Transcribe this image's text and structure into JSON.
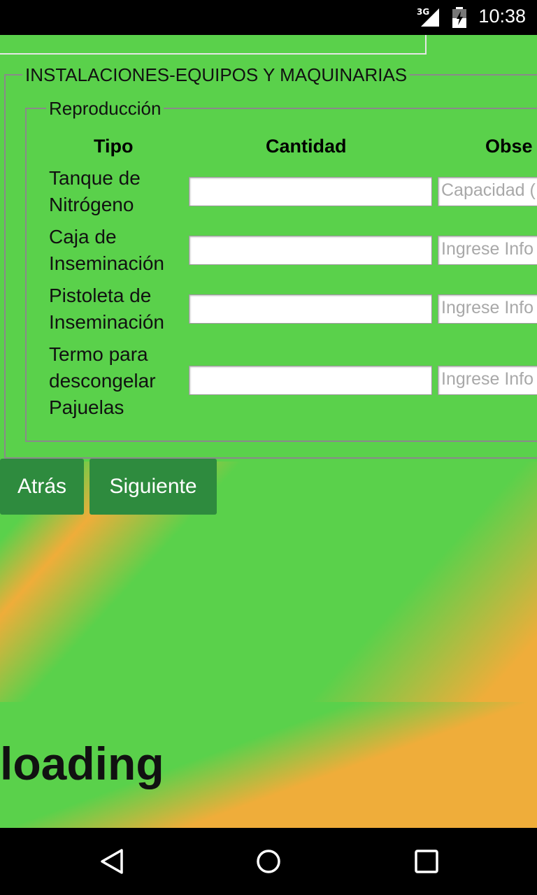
{
  "status_bar": {
    "network": "3G",
    "time": "10:38"
  },
  "form": {
    "section_title": "INSTALACIONES-EQUIPOS Y MAQUINARIAS",
    "subsection_title": "Reproducción",
    "columns": [
      "Tipo",
      "Cantidad",
      "Obse"
    ],
    "rows": [
      {
        "label": "Tanque de Nitrógeno",
        "placeholder": "Capacidad ("
      },
      {
        "label": "Caja de Inseminación",
        "placeholder": "Ingrese Info"
      },
      {
        "label": "Pistoleta de Inseminación",
        "placeholder": "Ingrese Info"
      },
      {
        "label": "Termo para descongelar Pajuelas",
        "placeholder": "Ingrese Info"
      }
    ]
  },
  "buttons": {
    "back": "Atrás",
    "next": "Siguiente"
  },
  "loading_text": "loading",
  "nav": {
    "icons": [
      "back-icon",
      "home-icon",
      "recents-icon"
    ]
  }
}
